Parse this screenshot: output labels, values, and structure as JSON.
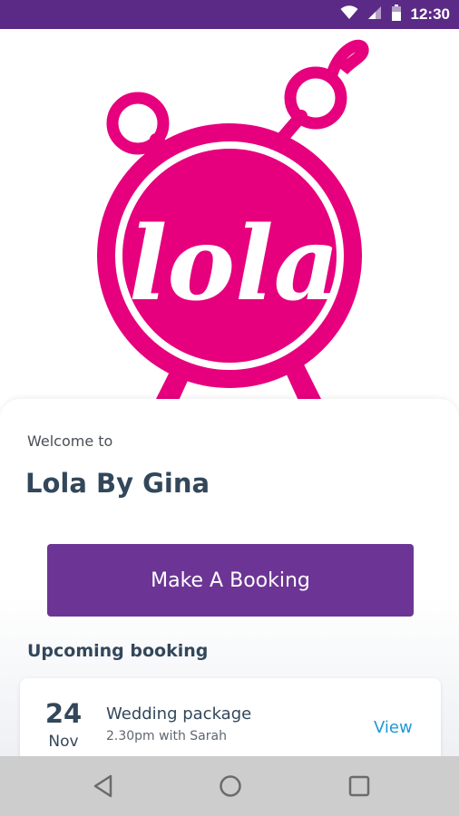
{
  "status_bar": {
    "time": "12:30",
    "icons": [
      "wifi-icon",
      "signal-icon",
      "battery-icon"
    ],
    "background": "#5b2a86"
  },
  "logo": {
    "text": "lola",
    "color": "#e6007e"
  },
  "home": {
    "welcome_text": "Welcome to",
    "business_name": "Lola By Gina",
    "booking_button_label": "Make A Booking",
    "upcoming_title": "Upcoming booking"
  },
  "upcoming_booking": {
    "day": "24",
    "month": "Nov",
    "title": "Wedding package",
    "detail": "2.30pm with Sarah",
    "action_label": "View"
  },
  "nav_bar": {
    "buttons": [
      "back-icon",
      "home-icon",
      "recents-icon"
    ]
  },
  "colors": {
    "accent": "#6c3595",
    "brand_pink": "#e6007e",
    "link": "#1e9ad6",
    "heading": "#33475b"
  }
}
